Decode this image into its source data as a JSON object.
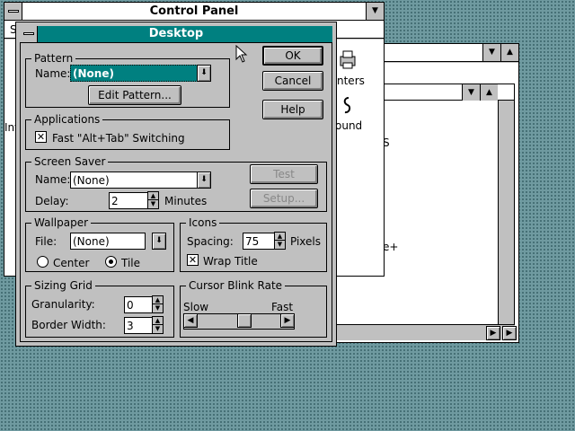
{
  "control_panel": {
    "title": "Control Panel",
    "menu_partial": "S",
    "partial_label_left": "Int",
    "partial_label_printers": "nters",
    "partial_label_sound": "ound"
  },
  "back_window": {
    "partial_text_1": "S",
    "partial_text_2": "e+"
  },
  "dialog": {
    "title": "Desktop",
    "buttons": {
      "ok": "OK",
      "cancel": "Cancel",
      "help": "Help"
    },
    "pattern": {
      "group": "Pattern",
      "name_label": "Name:",
      "name_value": "(None)",
      "edit_button": "Edit Pattern..."
    },
    "applications": {
      "group": "Applications",
      "fast_switch_label": "Fast \"Alt+Tab\" Switching",
      "fast_switch_checked": true
    },
    "screen_saver": {
      "group": "Screen Saver",
      "name_label": "Name:",
      "name_value": "(None)",
      "delay_label": "Delay:",
      "delay_value": "2",
      "delay_unit": "Minutes",
      "test_button": "Test",
      "setup_button": "Setup..."
    },
    "wallpaper": {
      "group": "Wallpaper",
      "file_label": "File:",
      "file_value": "(None)",
      "center_label": "Center",
      "tile_label": "Tile",
      "selected": "Tile"
    },
    "icons": {
      "group": "Icons",
      "spacing_label": "Spacing:",
      "spacing_value": "75",
      "spacing_unit": "Pixels",
      "wrap_title_label": "Wrap Title",
      "wrap_title_checked": true
    },
    "sizing_grid": {
      "group": "Sizing Grid",
      "granularity_label": "Granularity:",
      "granularity_value": "0",
      "border_width_label": "Border Width:",
      "border_width_value": "3"
    },
    "cursor_blink": {
      "group": "Cursor Blink Rate",
      "slow_label": "Slow",
      "fast_label": "Fast",
      "rate_fraction": 0.6
    }
  },
  "icons": {
    "system_menu": "system-menu-icon",
    "dropdown": "chevron-down-icon",
    "check": "x-mark"
  }
}
